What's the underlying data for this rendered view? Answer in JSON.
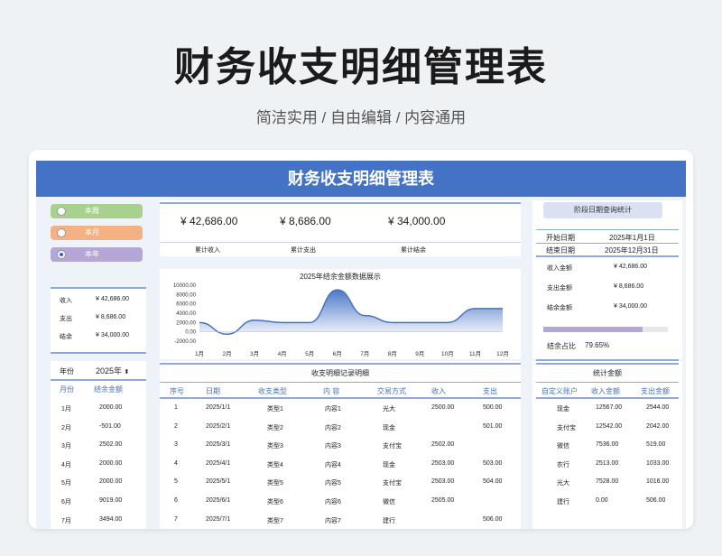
{
  "hero": {
    "title": "财务收支明细管理表",
    "subtitle": "简洁实用 / 自由编辑 / 内容通用"
  },
  "banner": "财务收支明细管理表",
  "period_options": [
    {
      "label": "本周",
      "color": "#a9d18e",
      "selected": false
    },
    {
      "label": "本月",
      "color": "#f4b183",
      "selected": false
    },
    {
      "label": "本年",
      "color": "#b4a7d6",
      "selected": true
    }
  ],
  "left_summary": [
    {
      "label": "收入",
      "value": "¥ 42,686.00"
    },
    {
      "label": "支出",
      "value": "¥ 8,686.00"
    },
    {
      "label": "结余",
      "value": "¥ 34,000.00"
    }
  ],
  "totals": [
    {
      "value": "¥ 42,686.00",
      "label": "累计收入"
    },
    {
      "value": "¥ 8,686.00",
      "label": "累计支出"
    },
    {
      "value": "¥ 34,000.00",
      "label": "累计结余"
    }
  ],
  "chart_data": {
    "type": "area",
    "title": "2025年结余金额数据展示",
    "categories": [
      "1月",
      "2月",
      "3月",
      "4月",
      "5月",
      "6月",
      "7月",
      "8月",
      "9月",
      "10月",
      "11月",
      "12月"
    ],
    "values": [
      2000,
      -501,
      2502,
      2000,
      2000,
      9019,
      3494,
      2000,
      2000,
      2000,
      5000,
      5000
    ],
    "yticks": [
      "10000.00",
      "8000.00",
      "6000.00",
      "4000.00",
      "2000.00",
      "0.00",
      "-2000.00"
    ],
    "ylim": [
      -2000,
      10000
    ],
    "color": "#4472c4"
  },
  "query": {
    "button": "阶段日期查询统计",
    "start_label": "开始日期",
    "start_value": "2025年1月1日",
    "end_label": "结束日期",
    "end_value": "2025年12月31日",
    "rows": [
      {
        "label": "收入金额",
        "value": "¥ 42,686.00"
      },
      {
        "label": "支出金额",
        "value": "¥ 8,686.00"
      },
      {
        "label": "结余金额",
        "value": "¥ 34,000.00"
      }
    ],
    "ratio_label": "结余占比",
    "ratio_value": "79.65%",
    "ratio": 0.7965
  },
  "monthly": {
    "year_label": "年份",
    "year_value": "2025年",
    "headers": [
      "月份",
      "结余金额"
    ],
    "rows": [
      [
        "1月",
        "2000.00"
      ],
      [
        "2月",
        "-501.00"
      ],
      [
        "3月",
        "2502.00"
      ],
      [
        "4月",
        "2000.00"
      ],
      [
        "5月",
        "2000.00"
      ],
      [
        "6月",
        "9019.00"
      ],
      [
        "7月",
        "3494.00"
      ]
    ]
  },
  "records": {
    "title": "收支明细记录明细",
    "headers": [
      "序号",
      "日期",
      "收支类型",
      "内 容",
      "交易方式",
      "收入",
      "支出"
    ],
    "rows": [
      [
        "1",
        "2025/1/1",
        "类型1",
        "内容1",
        "光大",
        "2500.00",
        "500.00"
      ],
      [
        "2",
        "2025/2/1",
        "类型2",
        "内容2",
        "现金",
        "",
        "501.00"
      ],
      [
        "3",
        "2025/3/1",
        "类型3",
        "内容3",
        "支付宝",
        "2502.00",
        ""
      ],
      [
        "4",
        "2025/4/1",
        "类型4",
        "内容4",
        "现金",
        "2503.00",
        "503.00"
      ],
      [
        "5",
        "2025/5/1",
        "类型5",
        "内容5",
        "支付宝",
        "2503.00",
        "504.00"
      ],
      [
        "6",
        "2025/6/1",
        "类型6",
        "内容6",
        "微信",
        "2505.00",
        ""
      ],
      [
        "7",
        "2025/7/1",
        "类型7",
        "内容7",
        "建行",
        "",
        "506.00"
      ]
    ]
  },
  "accounts": {
    "title": "统计金额",
    "headers": [
      "自定义账户",
      "收入金额",
      "支出金额"
    ],
    "rows": [
      [
        "现金",
        "12567.00",
        "2544.00"
      ],
      [
        "支付宝",
        "12542.00",
        "2042.00"
      ],
      [
        "微信",
        "7536.00",
        "519.00"
      ],
      [
        "农行",
        "2513.00",
        "1033.00"
      ],
      [
        "光大",
        "7528.00",
        "1016.00"
      ],
      [
        "建行",
        "0.00",
        "506.00"
      ]
    ]
  }
}
